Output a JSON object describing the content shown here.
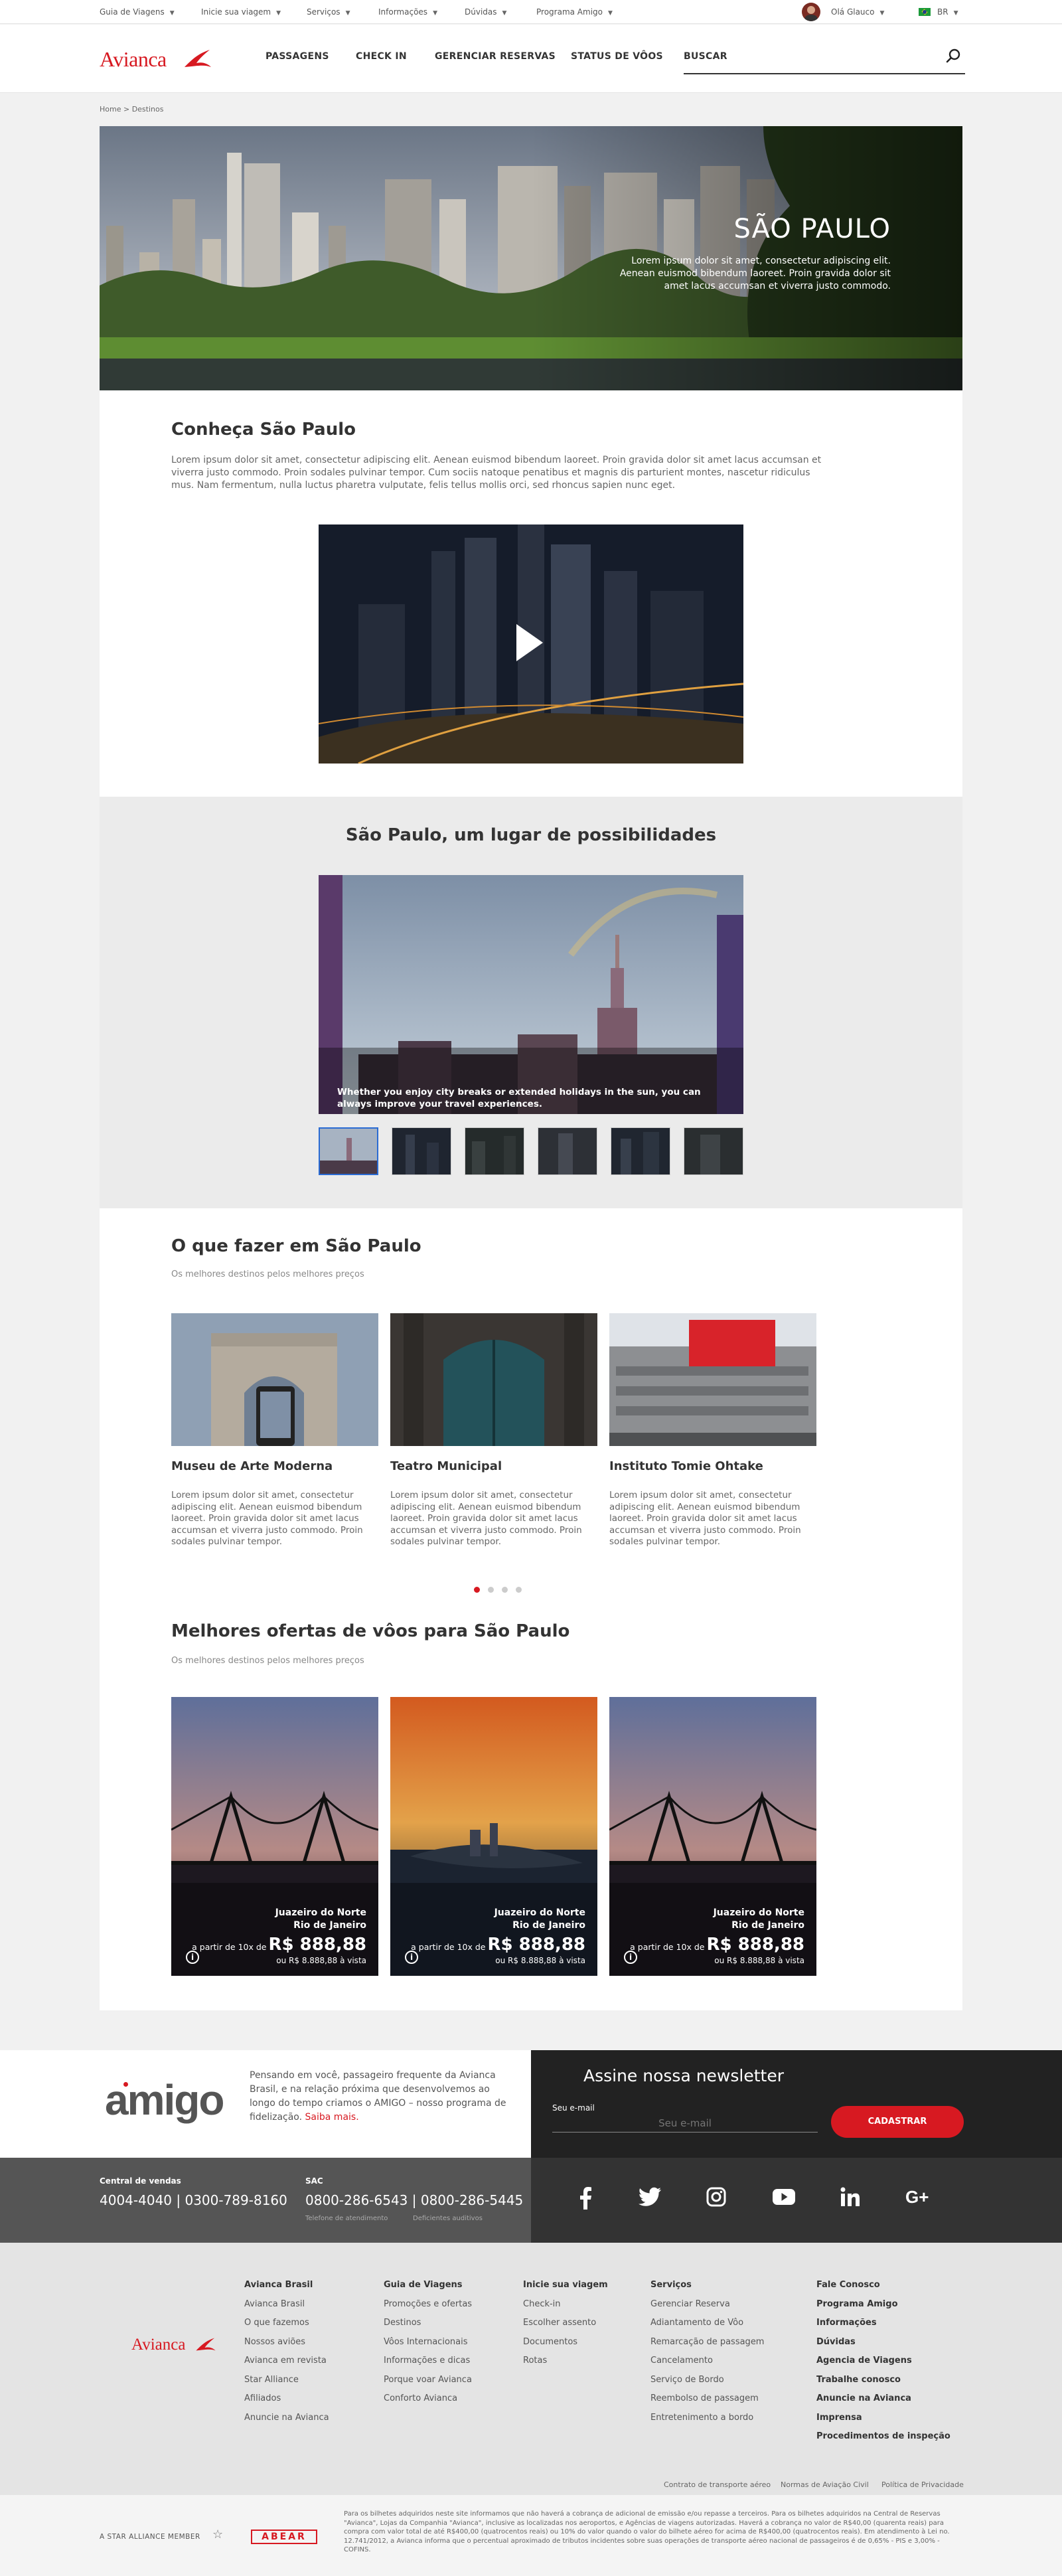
{
  "topbar": {
    "items": [
      "Guia de Viagens",
      "Inicie sua viagem",
      "Serviços",
      "Informações",
      "Dúvidas",
      "Programa Amigo"
    ],
    "greeting": "Olá Glauco",
    "country": "BR"
  },
  "header": {
    "logo": "Avianca",
    "nav": [
      "PASSAGENS",
      "CHECK IN",
      "GERENCIAR RESERVAS",
      "STATUS DE VÔOS"
    ],
    "search_label": "BUSCAR",
    "search_icon": "search-icon"
  },
  "breadcrumb": "Home > Destinos",
  "hero": {
    "title": "SÃO PAULO",
    "text": "Lorem ipsum dolor sit amet, consectetur adipiscing elit. Aenean euismod bibendum laoreet. Proin gravida dolor sit amet lacus accumsan et viverra justo commodo."
  },
  "intro": {
    "title": "Conheça São Paulo",
    "text": "Lorem ipsum dolor sit amet, consectetur adipiscing elit. Aenean euismod bibendum laoreet. Proin gravida dolor sit amet lacus accumsan et viverra justo commodo. Proin sodales pulvinar tempor. Cum sociis natoque penatibus et magnis dis parturient montes, nascetur ridiculus mus. Nam fermentum, nulla luctus pharetra vulputate, felis tellus mollis orci, sed rhoncus sapien nunc eget."
  },
  "gallery": {
    "title": "São Paulo, um lugar de possibilidades",
    "caption": "Whether you enjoy city breaks or extended holidays in the sun, you can always improve your travel experiences.",
    "thumbnail_count": 6,
    "selected_index": 0
  },
  "todo": {
    "title": "O que fazer em São Paulo",
    "subtitle": "Os melhores destinos pelos melhores preços",
    "cards": [
      {
        "title": "Museu de Arte Moderna",
        "text": "Lorem ipsum dolor sit amet, consectetur adipiscing elit. Aenean euismod bibendum laoreet. Proin gravida dolor sit amet lacus accumsan et viverra justo commodo. Proin sodales pulvinar tempor."
      },
      {
        "title": "Teatro Municipal",
        "text": "Lorem ipsum dolor sit amet, consectetur adipiscing elit. Aenean euismod bibendum laoreet. Proin gravida dolor sit amet lacus accumsan et viverra justo commodo. Proin sodales pulvinar tempor."
      },
      {
        "title": "Instituto Tomie Ohtake",
        "text": "Lorem ipsum dolor sit amet, consectetur adipiscing elit. Aenean euismod bibendum laoreet. Proin gravida dolor sit amet lacus accumsan et viverra justo commodo. Proin sodales pulvinar tempor."
      }
    ],
    "pagination_count": 4,
    "pagination_active": 0
  },
  "offers": {
    "title": "Melhores ofertas de vôos para  São Paulo",
    "subtitle": "Os melhores destinos pelos melhores preços",
    "cards": [
      {
        "from": "Juazeiro do Norte",
        "to": "Rio de Janeiro",
        "installment_prefix": "a partir de 10x de",
        "price": "R$ 888,88",
        "cash": "ou R$ 8.888,88 à vista"
      },
      {
        "from": "Juazeiro do Norte",
        "to": "Rio de Janeiro",
        "installment_prefix": "a partir de 10x de",
        "price": "R$ 888,88",
        "cash": "ou R$ 8.888,88 à vista"
      },
      {
        "from": "Juazeiro do Norte",
        "to": "Rio de Janeiro",
        "installment_prefix": "a partir de 10x de",
        "price": "R$ 888,88",
        "cash": "ou R$ 8.888,88 à vista"
      }
    ]
  },
  "amigo": {
    "logo": "amigo",
    "text": "Pensando em você, passageiro frequente da Avianca Brasil, e na relação próxima que desenvolvemos ao longo do tempo criamos o AMIGO – nosso programa de fidelização.",
    "link": "Saiba mais."
  },
  "newsletter": {
    "title": "Assine nossa newsletter",
    "email_label": "Seu e-mail",
    "email_placeholder": "Seu e-mail",
    "button": "CADASTRAR"
  },
  "contact": {
    "sales_label": "Central de vendas",
    "sales_numbers": "4004-4040  |  0300-789-8160",
    "sac_label": "SAC",
    "sac_numbers": "0800-286-6543  |  0800-286-5445",
    "sac_note1": "Telefone de atendimento",
    "sac_note2": "Deficientes auditivos"
  },
  "social": [
    "facebook-icon",
    "twitter-icon",
    "instagram-icon",
    "youtube-icon",
    "linkedin-icon",
    "google-plus-icon"
  ],
  "footer": {
    "logo": "Avianca",
    "columns": [
      {
        "heading": "Avianca Brasil",
        "links": [
          "Avianca Brasil",
          "O que fazemos",
          "Nossos aviões",
          "Avianca em revista",
          "Star Alliance",
          "Afiliados",
          "Anuncie na Avianca"
        ]
      },
      {
        "heading": "Guia de Viagens",
        "links": [
          "Promoções e ofertas",
          "Destinos",
          "Vôos Internacionais",
          "Informações e dicas",
          "Porque voar Avianca",
          "Conforto Avianca"
        ]
      },
      {
        "heading": "Inicie sua viagem",
        "links": [
          "Check-in",
          "Escolher assento",
          "Documentos",
          "Rotas"
        ]
      },
      {
        "heading": "Serviços",
        "links": [
          "Gerenciar Reserva",
          "Adiantamento de Vôo",
          "Remarcação de passagem",
          "Cancelamento",
          "Serviço de Bordo",
          "Reembolso de passagem",
          "Entretenimento a bordo"
        ]
      }
    ],
    "right_links": [
      "Fale Conosco",
      "Programa Amigo",
      "Informações",
      "Dúvidas",
      "Agencia de Viagens",
      "Trabalhe conosco",
      "Anuncie na Avianca",
      "Imprensa",
      "Procedimentos de inspeção"
    ],
    "legal_links": [
      "Contrato de transporte aéreo",
      "Normas de Aviação Civil",
      "Política de Privacidade"
    ],
    "star_alliance": "A STAR ALLIANCE MEMBER",
    "abear": "ABEAR",
    "disclaimer": "Para os bilhetes adquiridos neste site informamos que não haverá a cobrança de adicional de emissão e/ou repasse a terceiros. Para os bilhetes adquiridos na Central de Reservas \"Avianca\", Lojas da Companhia \"Avianca\", inclusive as localizadas nos aeroportos, e Agências de viagens autorizadas. Haverá a cobrança no valor de R$40,00 (quarenta reais) para compra com valor total de até R$400,00 (quatrocentos reais) ou 10% do valor quando o valor do bilhete aéreo for acima de R$400,00 (quatrocentos reais). Em atendimento à Lei no. 12.741/2012, a Avianca informa que o percentual aproximado de tributos incidentes sobre suas operações de transporte aéreo nacional de passageiros é de 0,65% - PIS e 3,00% - COFINS."
  },
  "colors": {
    "brand_red": "#d71921",
    "dark": "#222222",
    "footer_grey": "#e4e4e4"
  }
}
